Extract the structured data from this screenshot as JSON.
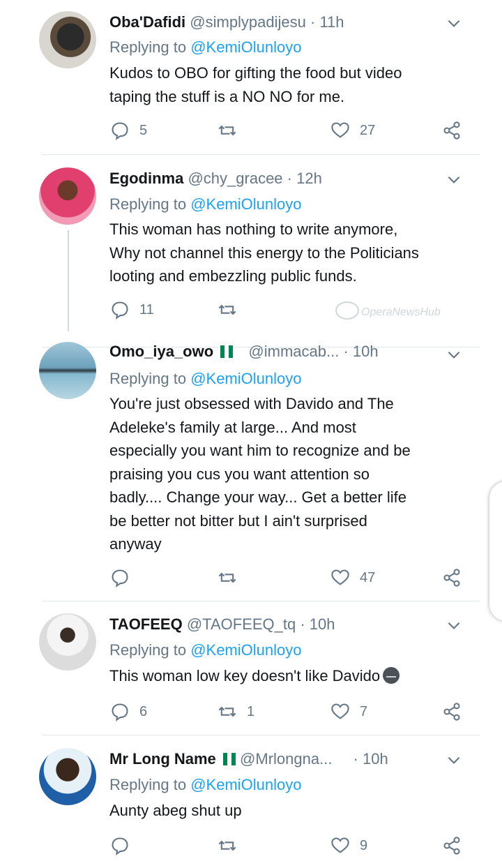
{
  "tweets": [
    {
      "name": "Oba'Dafidi",
      "handle": "@simplypadijesu",
      "time": " · 11h",
      "replying_prefix": "Replying to ",
      "replying_to": "@KemiOlunloyo",
      "lines": [
        "Kudos to OBO for gifting the food but video",
        "taping the stuff is a NO NO for me."
      ],
      "replies": "5",
      "retweets": "",
      "likes": "27"
    },
    {
      "name": "Egodinma",
      "handle": "@chy_gracee",
      "time": " · 12h",
      "replying_prefix": "Replying to ",
      "replying_to": "@KemiOlunloyo",
      "lines": [
        "This woman has nothing to write anymore,",
        "Why not channel this energy to the Politicians",
        "looting and embezzling public funds."
      ],
      "replies": "11",
      "retweets": "",
      "likes": ""
    },
    {
      "name": "Omo_iya_owo",
      "handle": "@immacab...",
      "time": " · 10h",
      "replying_prefix": "Replying to ",
      "replying_to": "@KemiOlunloyo",
      "lines": [
        "You're just obsessed with Davido and The",
        "Adeleke's family at large... And most",
        "especially you want him to recognize and be",
        "praising you cus you want attention so",
        "badly.... Change your way... Get a better life",
        "be better not bitter but I ain't surprised",
        "anyway"
      ],
      "replies": "",
      "retweets": "",
      "likes": "47"
    },
    {
      "name": "TAOFEEQ",
      "handle": "@TAOFEEQ_tq",
      "time": " · 10h",
      "replying_prefix": "Replying to ",
      "replying_to": "@KemiOlunloyo",
      "lines": [
        "This woman low key doesn't like Davido"
      ],
      "replies": "6",
      "retweets": "1",
      "likes": "7"
    },
    {
      "name": "Mr Long Name",
      "handle": "@Mrlongna...",
      "time": " · 10h",
      "replying_prefix": "Replying to ",
      "replying_to": "@KemiOlunloyo",
      "lines": [
        "Aunty abeg shut up"
      ],
      "replies": "",
      "retweets": "",
      "likes": "9"
    }
  ],
  "watermark": "OperaNewsHub",
  "colors": {
    "mention": "#1da1f2",
    "muted": "#657786",
    "text": "#14171a",
    "divider": "#e1e8ed",
    "flag_green": "#008751"
  }
}
